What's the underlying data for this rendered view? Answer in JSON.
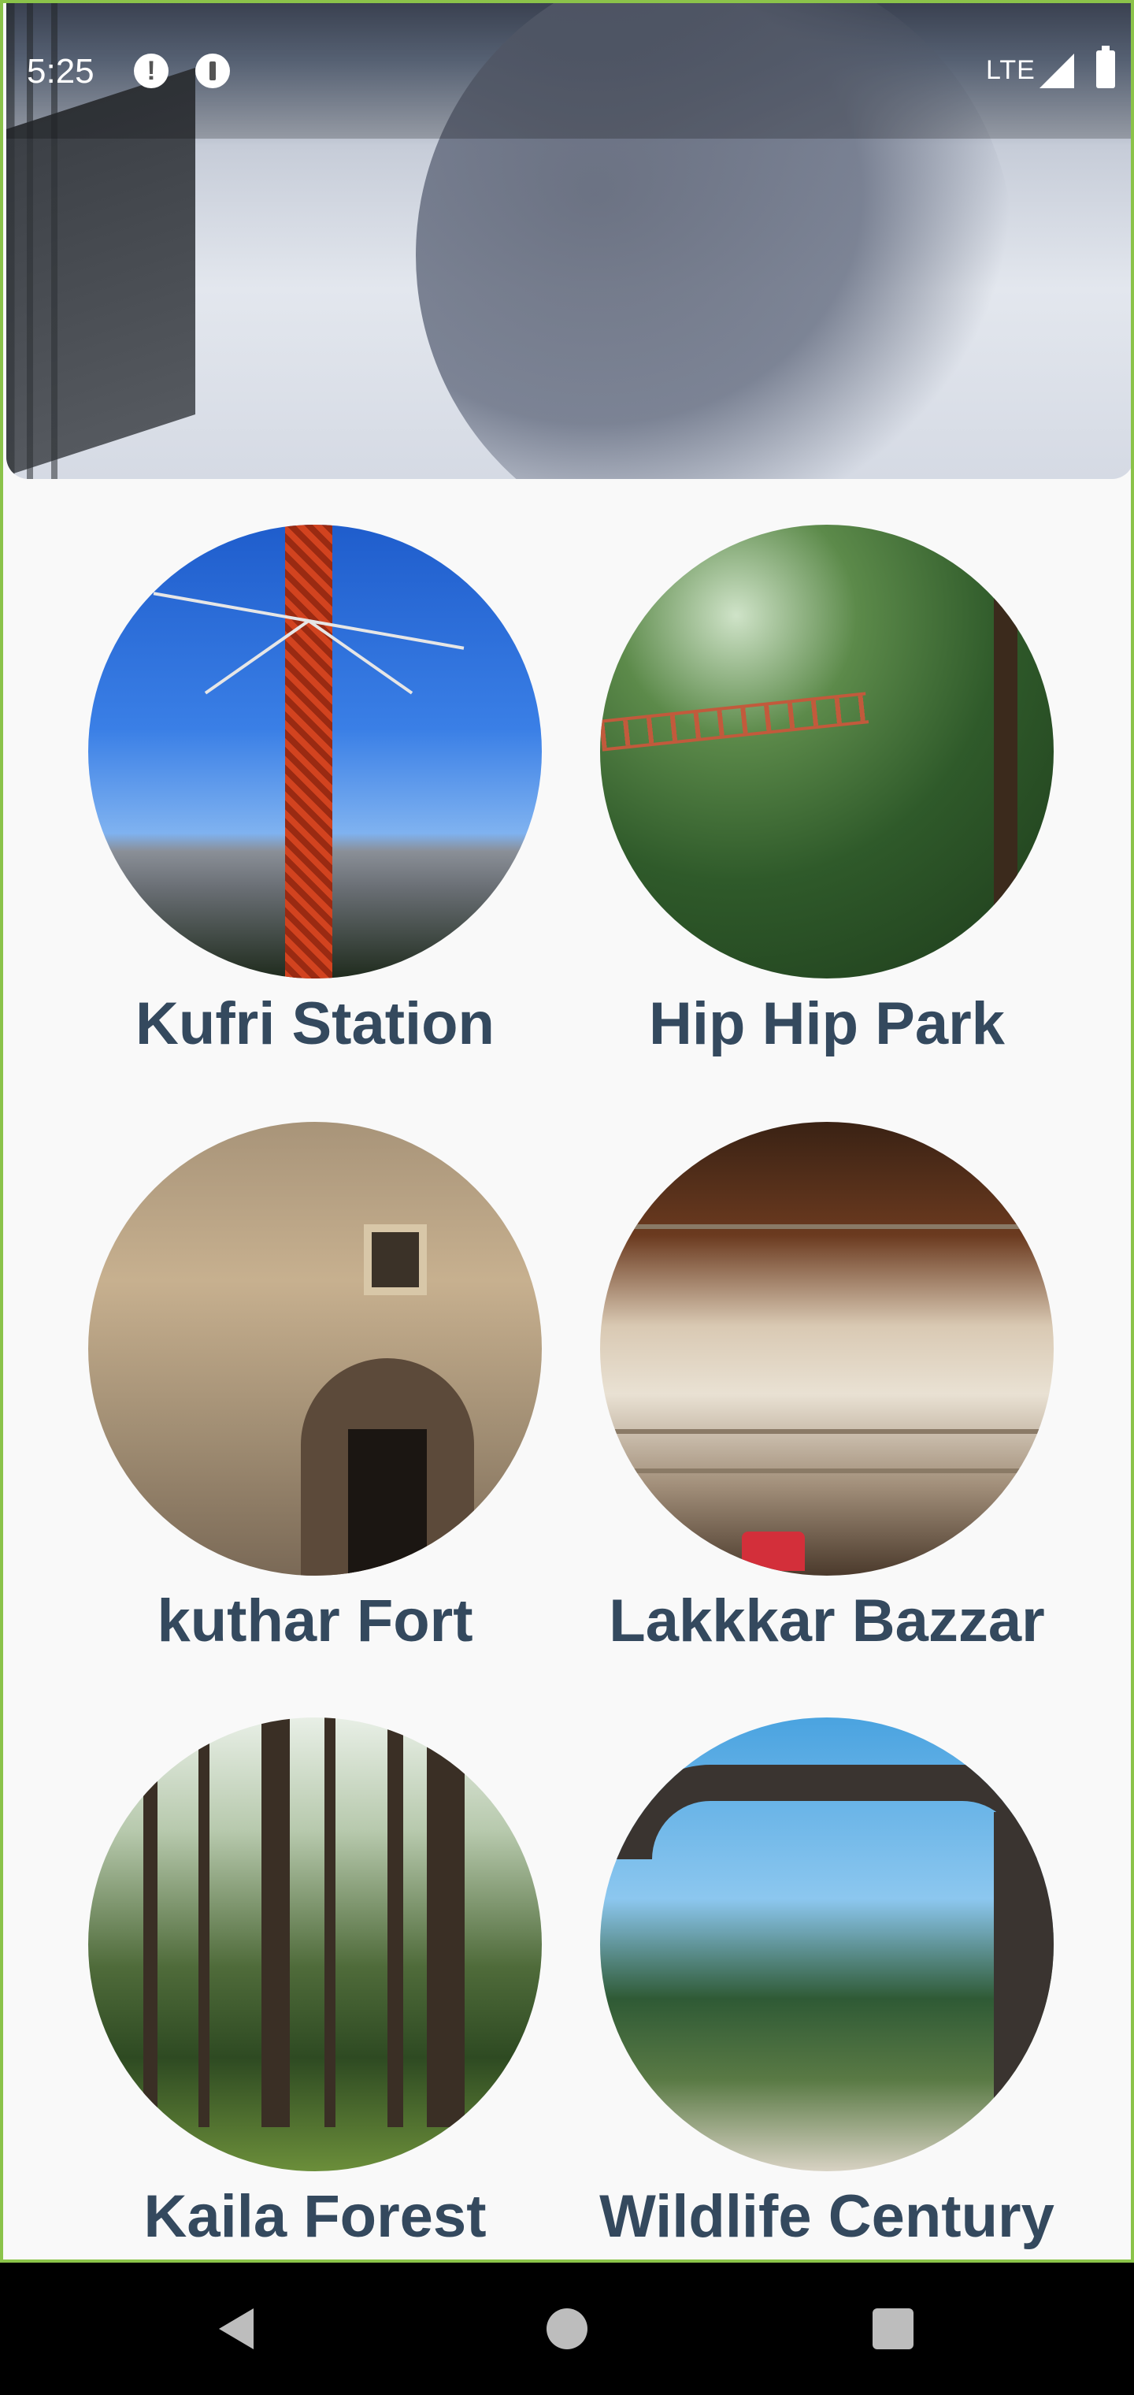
{
  "status_bar": {
    "time": "5:25",
    "alert_glyph": "!",
    "network": "LTE"
  },
  "hero": {
    "image": "snowy-mall-road-photo"
  },
  "places": [
    {
      "label": "Kufri Station",
      "image": "swing-ride-photo"
    },
    {
      "label": "Hip Hip Park",
      "image": "rope-bridge-forest-photo"
    },
    {
      "label": "kuthar Fort",
      "image": "fort-gateway-photo"
    },
    {
      "label": "Lakkkar Bazzar",
      "image": "market-shop-photo"
    },
    {
      "label": "Kaila Forest",
      "image": "pine-forest-photo"
    },
    {
      "label": "Wildlife Century",
      "image": "tree-arch-photo"
    }
  ],
  "colors": {
    "label": "#34495e",
    "background": "#f9f9f9",
    "frame": "#8bc34a"
  },
  "nav_bar": {
    "icons": [
      "back-icon",
      "home-icon",
      "recents-icon"
    ]
  }
}
